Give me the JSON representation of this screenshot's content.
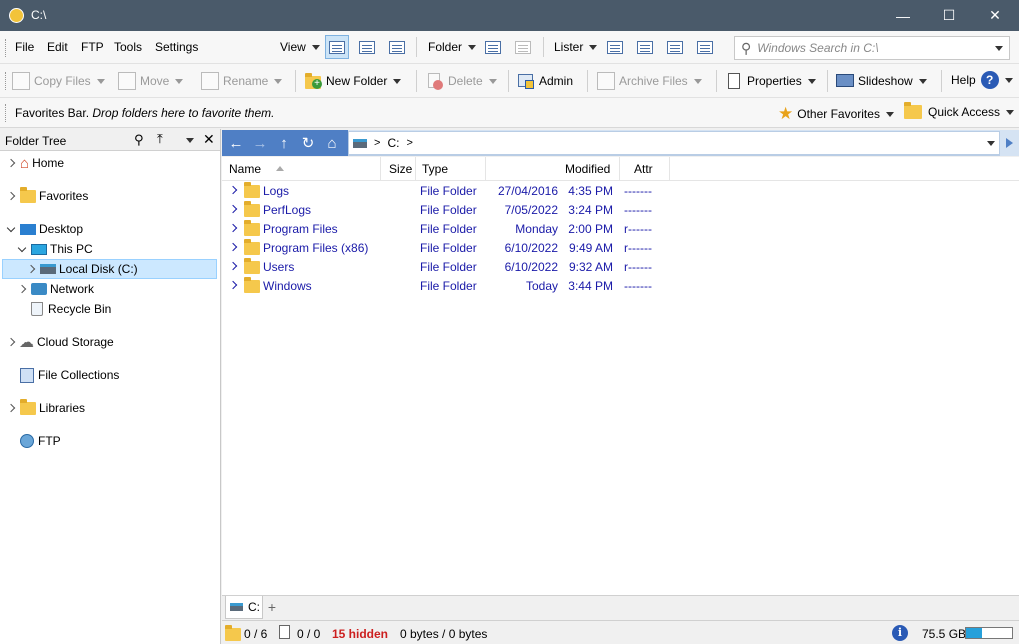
{
  "window": {
    "title": "C:\\"
  },
  "menu": [
    "File",
    "Edit",
    "FTP",
    "Tools",
    "Settings"
  ],
  "toolbar1": {
    "view_label": "View",
    "folder_label": "Folder",
    "lister_label": "Lister",
    "search_placeholder": "Windows Search in C:\\"
  },
  "toolbar2": {
    "copy_files": "Copy Files",
    "move": "Move",
    "rename": "Rename",
    "new_folder": "New Folder",
    "delete": "Delete",
    "admin": "Admin",
    "archive_files": "Archive Files",
    "properties": "Properties",
    "slideshow": "Slideshow",
    "help": "Help"
  },
  "favorites_bar": {
    "text": "Favorites Bar.",
    "hint": "Drop folders here to favorite them.",
    "other_favorites": "Other Favorites",
    "quick_access": "Quick Access"
  },
  "folder_tree": {
    "title": "Folder Tree",
    "items": [
      {
        "label": "Home"
      },
      {
        "label": "Favorites"
      },
      {
        "label": "Desktop"
      },
      {
        "label": "This PC"
      },
      {
        "label": "Local Disk (C:)"
      },
      {
        "label": "Network"
      },
      {
        "label": "Recycle Bin"
      },
      {
        "label": "Cloud Storage"
      },
      {
        "label": "File Collections"
      },
      {
        "label": "Libraries"
      },
      {
        "label": "FTP"
      }
    ]
  },
  "path": {
    "root": "C:",
    "sep": ">"
  },
  "columns": {
    "name": "Name",
    "size": "Size",
    "type": "Type",
    "modified": "Modified",
    "attr": "Attr"
  },
  "files": [
    {
      "name": "Logs",
      "type": "File Folder",
      "date": "27/04/2016",
      "time": "4:35 PM",
      "attr": "-------"
    },
    {
      "name": "PerfLogs",
      "type": "File Folder",
      "date": "7/05/2022",
      "time": "3:24 PM",
      "attr": "-------"
    },
    {
      "name": "Program Files",
      "type": "File Folder",
      "date": "Monday",
      "time": "2:00 PM",
      "attr": "r------"
    },
    {
      "name": "Program Files (x86)",
      "type": "File Folder",
      "date": "6/10/2022",
      "time": "9:49 AM",
      "attr": "r------"
    },
    {
      "name": "Users",
      "type": "File Folder",
      "date": "6/10/2022",
      "time": "9:32 AM",
      "attr": "r------"
    },
    {
      "name": "Windows",
      "type": "File Folder",
      "date": "Today",
      "time": "3:44 PM",
      "attr": "-------"
    }
  ],
  "tab": {
    "label": "C:",
    "add": "+"
  },
  "status": {
    "folders": "0 / 6",
    "files": "0 / 0",
    "hidden": "15 hidden",
    "bytes": "0 bytes / 0 bytes",
    "free": "75.5 GB",
    "disk_used_fraction": 0.35
  },
  "colors": {
    "accent": "#4f7fc5",
    "link": "#1a1aa8",
    "hidden": "#cc1f1f",
    "titlebar": "#4a5a6a"
  }
}
